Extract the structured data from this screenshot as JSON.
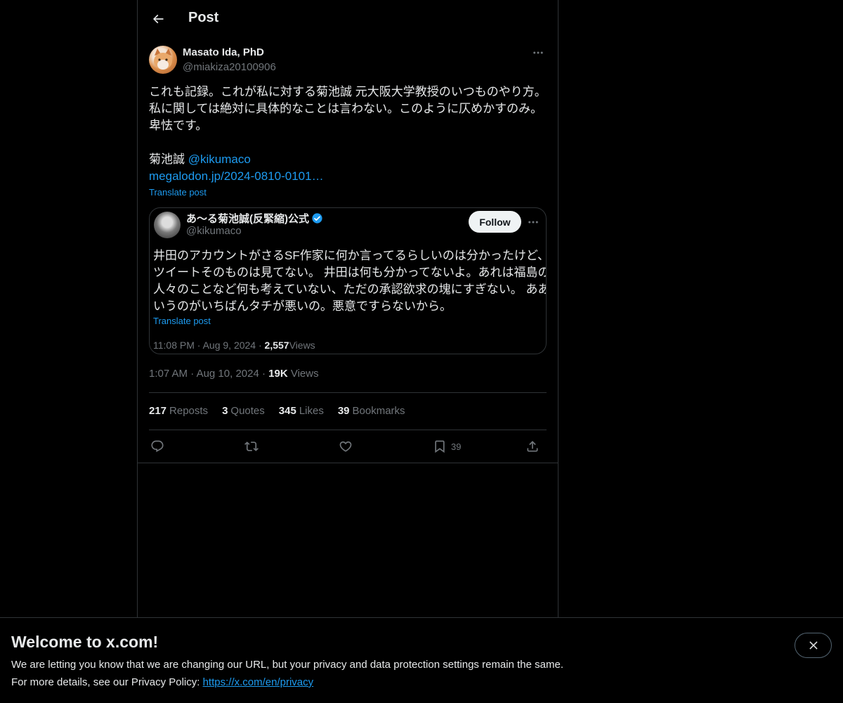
{
  "header": {
    "title": "Post"
  },
  "author": {
    "name": "Masato Ida, PhD",
    "handle": "@miakiza20100906"
  },
  "post": {
    "lines": [
      "これも記録。これが私に対する菊池誠 元大阪大学教授のいつものやり方。",
      "私に関しては絶対に具体的なことは言わない。このように仄めかすのみ。",
      "卑怯です。"
    ],
    "mention_prefix": "菊池誠 ",
    "mention": "@kikumaco",
    "url": "megalodon.jp/2024-0810-0101…",
    "translate_label": "Translate post"
  },
  "quote": {
    "name": "あ〜る菊池誠(反緊縮)公式",
    "handle": "@kikumaco",
    "follow_label": "Follow",
    "lines": [
      "井田のアカウントがさるSF作家に何か言ってるらしいのは分かったけど、",
      "ツイートそのものは見てない。 井田は何も分かってないよ。あれは福島の",
      "人々のことなど何も考えていない、ただの承認欲求の塊にすぎない。 ああ",
      "いうのがいちばんタチが悪いの。悪意ですらないから。"
    ],
    "translate_label": "Translate post",
    "time": "11:08 PM",
    "date": "Aug 9, 2024",
    "views_count": "2,557",
    "views_label": "Views",
    "sep": "·"
  },
  "meta": {
    "time": "1:07 AM",
    "date": "Aug 10, 2024",
    "views_count": "19K",
    "views_label": "Views",
    "sep": "·"
  },
  "stats": {
    "reposts_count": "217",
    "reposts_label": "Reposts",
    "quotes_count": "3",
    "quotes_label": "Quotes",
    "likes_count": "345",
    "likes_label": "Likes",
    "bookmarks_count": "39",
    "bookmarks_label": "Bookmarks"
  },
  "actions": {
    "bookmark_count": "39"
  },
  "banner": {
    "title": "Welcome to x.com!",
    "text1": "We are letting you know that we are changing our URL, but your privacy and data protection settings remain the same.",
    "text2_prefix": "For more details, see our Privacy Policy: ",
    "link": "https://x.com/en/privacy"
  },
  "colors": {
    "background": "#000000",
    "text": "#e7e9ea",
    "muted": "#71767b",
    "accent": "#1d9bf0",
    "border": "#2f3336"
  },
  "icons": [
    "back-arrow-icon",
    "more-icon",
    "verified-badge-icon",
    "reply-icon",
    "repost-icon",
    "like-icon",
    "bookmark-icon",
    "share-icon",
    "close-icon"
  ]
}
